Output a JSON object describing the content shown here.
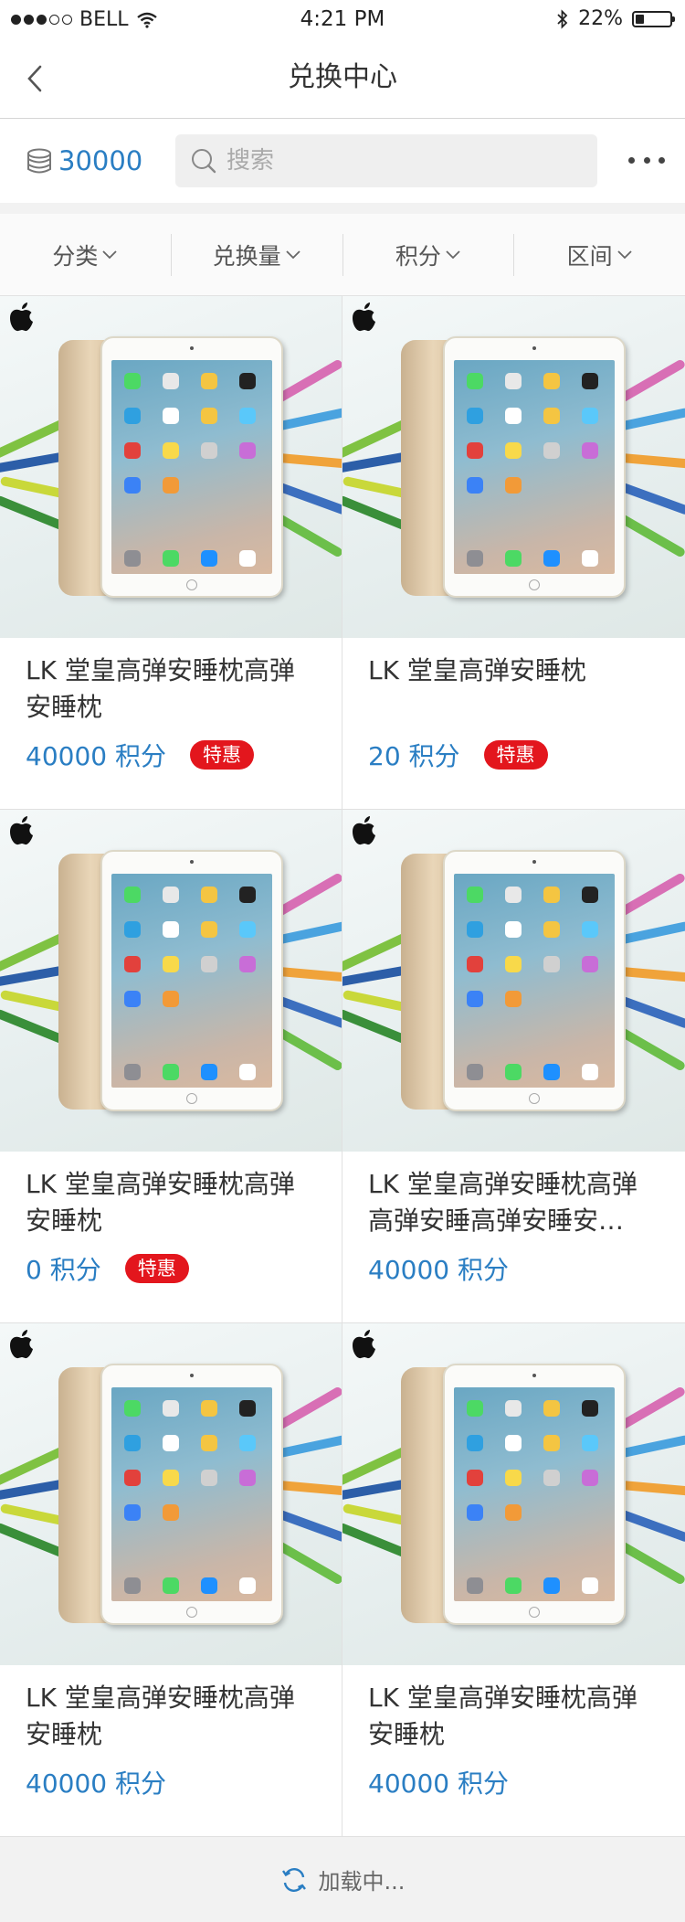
{
  "status_bar": {
    "carrier": "BELL",
    "time": "4:21 PM",
    "battery": "22%"
  },
  "nav": {
    "title": "兑换中心"
  },
  "account": {
    "points": "30000"
  },
  "search": {
    "placeholder": "搜索"
  },
  "filters": [
    {
      "label": "分类"
    },
    {
      "label": "兑换量"
    },
    {
      "label": "积分"
    },
    {
      "label": "区间"
    }
  ],
  "products": [
    {
      "title": "LK 堂皇高弹安睡枕高弹安睡枕",
      "points": "40000 积分",
      "badge": "特惠"
    },
    {
      "title": "LK 堂皇高弹安睡枕",
      "points": "20 积分",
      "badge": "特惠"
    },
    {
      "title": "LK 堂皇高弹安睡枕高弹安睡枕",
      "points": "0 积分",
      "badge": "特惠"
    },
    {
      "title": "LK 堂皇高弹安睡枕高弹高弹安睡高弹安睡安…",
      "points": "40000 积分",
      "badge": ""
    },
    {
      "title": "LK 堂皇高弹安睡枕高弹安睡枕",
      "points": "40000 积分",
      "badge": ""
    },
    {
      "title": "LK 堂皇高弹安睡枕高弹安睡枕",
      "points": "40000 积分",
      "badge": ""
    }
  ],
  "footer": {
    "loading_text": "加载中..."
  },
  "colors": {
    "accent": "#2a7ec3",
    "badge": "#e3161d"
  },
  "icons": {
    "back": "chevron-left-icon",
    "coins": "coin-stack-icon",
    "search": "search-icon",
    "more": "more-dots-icon",
    "loading": "refresh-icon"
  }
}
